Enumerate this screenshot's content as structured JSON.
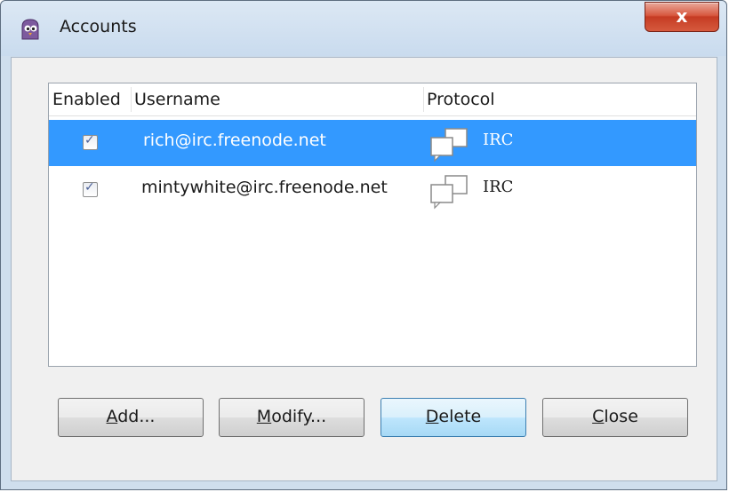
{
  "window": {
    "title": "Accounts",
    "close_glyph": "x",
    "app_icon": "pidgin-icon"
  },
  "columns": [
    "Enabled",
    "Username",
    "Protocol"
  ],
  "accounts": [
    {
      "enabled": true,
      "username": "rich@irc.freenode.net",
      "protocol": "IRC",
      "protocol_icon": "irc-chat-icon",
      "selected": true
    },
    {
      "enabled": true,
      "username": "mintywhite@irc.freenode.net",
      "protocol": "IRC",
      "protocol_icon": "irc-chat-icon",
      "selected": false
    }
  ],
  "buttons": {
    "add": {
      "mnemonic": "A",
      "rest": "dd..."
    },
    "modify": {
      "mnemonic": "M",
      "rest": "odify..."
    },
    "delete": {
      "mnemonic": "D",
      "rest": "elete"
    },
    "close": {
      "mnemonic": "C",
      "rest": "lose"
    }
  },
  "colors": {
    "selection": "#3399ff",
    "titlebar": "#cfdeed",
    "close_button": "#c53b23"
  }
}
